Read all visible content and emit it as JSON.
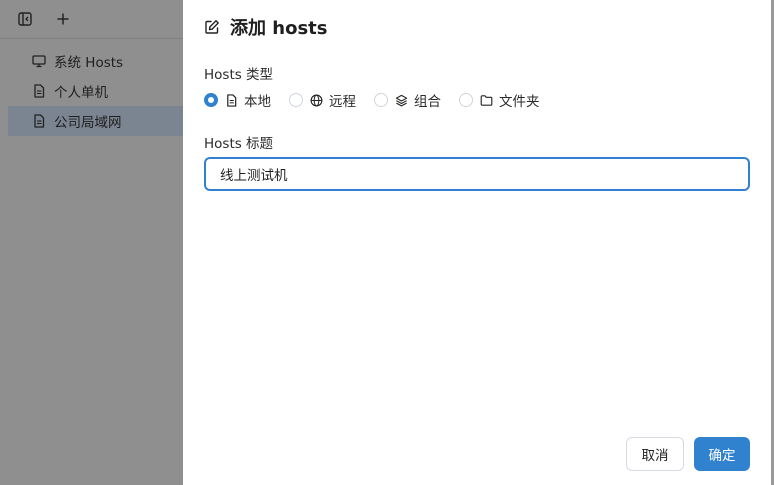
{
  "sidebar": {
    "toolbar": {
      "toggle_icon": "sidebar-toggle-icon",
      "add_icon": "plus-icon"
    },
    "items": [
      {
        "label": "系统 Hosts",
        "icon": "monitor-icon",
        "selected": false
      },
      {
        "label": "个人单机",
        "icon": "file-icon",
        "selected": false
      },
      {
        "label": "公司局域网",
        "icon": "file-icon",
        "selected": true
      }
    ]
  },
  "dialog": {
    "title": "添加 hosts",
    "title_icon": "edit-icon",
    "type_label": "Hosts 类型",
    "type_options": [
      {
        "label": "本地",
        "icon": "file-icon",
        "checked": true
      },
      {
        "label": "远程",
        "icon": "globe-icon",
        "checked": false
      },
      {
        "label": "组合",
        "icon": "layers-icon",
        "checked": false
      },
      {
        "label": "文件夹",
        "icon": "folder-icon",
        "checked": false
      }
    ],
    "title_field_label": "Hosts 标题",
    "title_field_value": "线上测试机",
    "cancel_label": "取消",
    "ok_label": "确定"
  },
  "colors": {
    "accent": "#3182ce",
    "overlay": "#8f8f8f",
    "selected_row": "#7b8591"
  }
}
